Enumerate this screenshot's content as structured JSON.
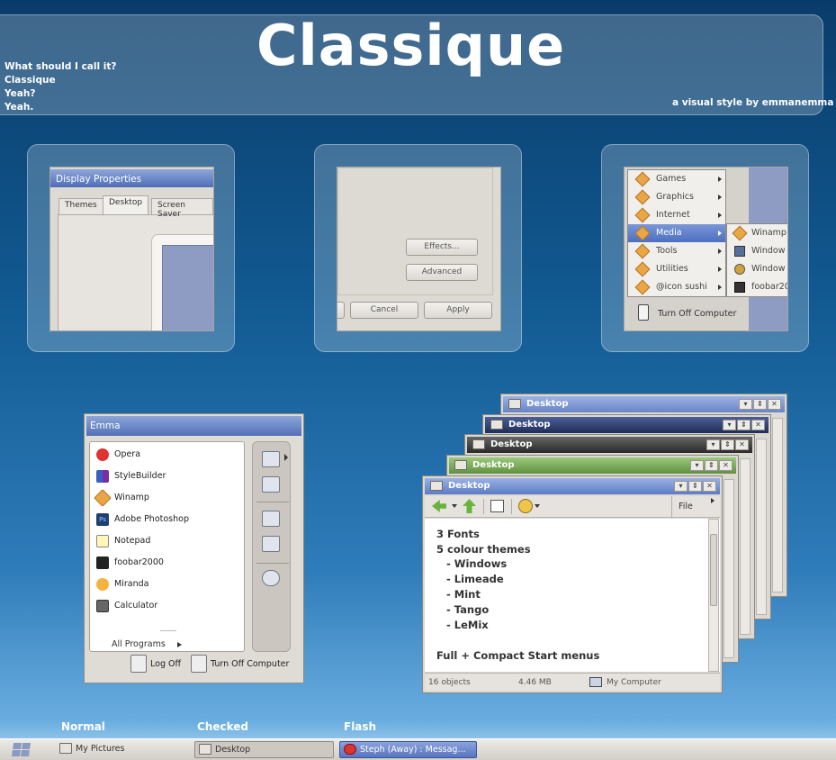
{
  "header": {
    "title": "Classique",
    "intro_lines": [
      "What should I call it?",
      "Classique",
      "Yeah?",
      "Yeah."
    ],
    "byline": "a visual style by emmanemma"
  },
  "tile1": {
    "window_title": "Display Properties",
    "tabs": [
      "Themes",
      "Desktop",
      "Screen Saver"
    ]
  },
  "tile2": {
    "buttons": [
      "Effects...",
      "Advanced",
      "Cancel",
      "Apply"
    ]
  },
  "tile3": {
    "menu_items": [
      "Games",
      "Graphics",
      "Internet",
      "Media",
      "Tools",
      "Utilities",
      "@icon sushi"
    ],
    "submenu_items": [
      "Winamp",
      "Window",
      "Window",
      "foobar20"
    ],
    "turn_off": "Turn Off Computer"
  },
  "start_menu": {
    "user": "Emma",
    "programs": [
      "Opera",
      "StyleBuilder",
      "Winamp",
      "Adobe Photoshop",
      "Notepad",
      "foobar2000",
      "Miranda",
      "Calculator"
    ],
    "all_programs": "All Programs",
    "log_off": "Log Off",
    "turn_off": "Turn Off Computer"
  },
  "windows": {
    "title": "Desktop",
    "menu_file": "File",
    "content": [
      "3 Fonts",
      "5 colour themes",
      "- Windows",
      "- Limeade",
      "- Mint",
      "- Tango",
      "- LeMix",
      "Full + Compact Start menus"
    ],
    "status_objects": "16 objects",
    "status_size": "4.46 MB",
    "status_location": "My Computer",
    "title_colors": [
      "#7f9bd6",
      "#2d3f74",
      "#3a3a3a",
      "#6e9e4c",
      "#6d8fd3"
    ]
  },
  "taskbar": {
    "labels": [
      "Normal",
      "Checked",
      "Flash"
    ],
    "buttons": [
      "My Pictures",
      "Desktop",
      "Steph (Away) : Messag..."
    ]
  }
}
